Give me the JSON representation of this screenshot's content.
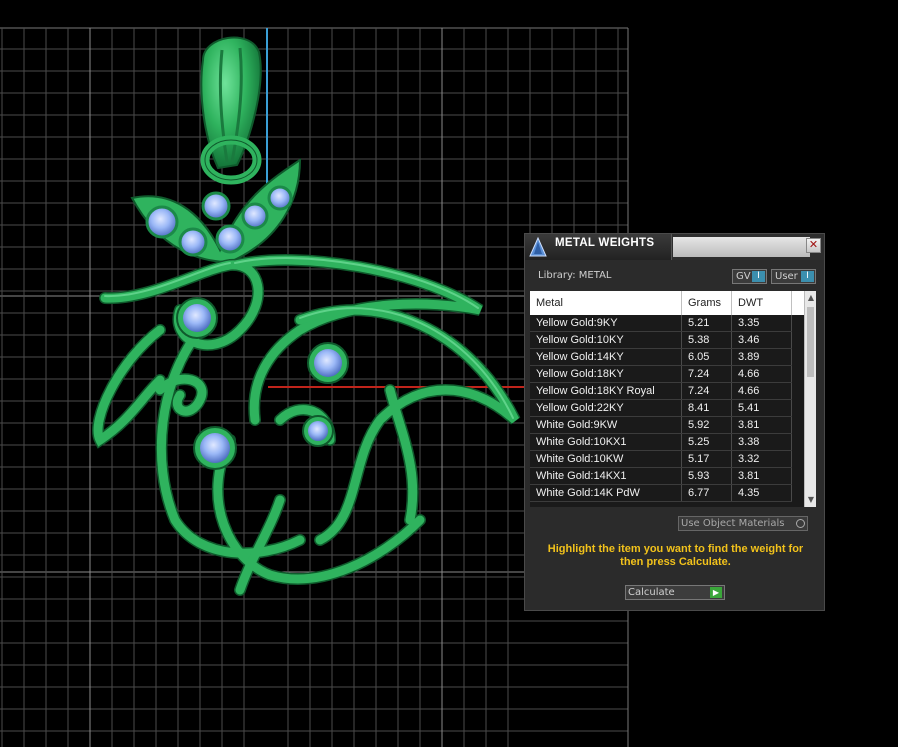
{
  "panel": {
    "title": "METAL WEIGHTS",
    "close_label": "✕",
    "library_label": "Library: METAL",
    "toggle_gv_label": "GV",
    "toggle_user_label": "User",
    "toggle_knob": "I",
    "columns": [
      "Metal",
      "Grams",
      "DWT"
    ],
    "rows": [
      {
        "metal": "Yellow Gold:9KY",
        "grams": "5.21",
        "dwt": "3.35"
      },
      {
        "metal": "Yellow Gold:10KY",
        "grams": "5.38",
        "dwt": "3.46"
      },
      {
        "metal": "Yellow Gold:14KY",
        "grams": "6.05",
        "dwt": "3.89"
      },
      {
        "metal": "Yellow Gold:18KY",
        "grams": "7.24",
        "dwt": "4.66"
      },
      {
        "metal": "Yellow Gold:18KY Royal",
        "grams": "7.24",
        "dwt": "4.66"
      },
      {
        "metal": "Yellow Gold:22KY",
        "grams": "8.41",
        "dwt": "5.41"
      },
      {
        "metal": "White Gold:9KW",
        "grams": "5.92",
        "dwt": "3.81"
      },
      {
        "metal": "White Gold:10KX1",
        "grams": "5.25",
        "dwt": "3.38"
      },
      {
        "metal": "White Gold:10KW",
        "grams": "5.17",
        "dwt": "3.32"
      },
      {
        "metal": "White Gold:14KX1",
        "grams": "5.93",
        "dwt": "3.81"
      },
      {
        "metal": "White Gold:14K PdW",
        "grams": "6.77",
        "dwt": "4.35"
      }
    ],
    "use_object_materials_label": "Use Object Materials",
    "instructions": "Highlight the item you want to find the weight for then press Calculate.",
    "calculate_label": "Calculate",
    "calculate_icon": "play-icon"
  },
  "colors": {
    "background": "#000000",
    "grid": "#555555",
    "model_green": "#2fb35e",
    "gem_blue": "#8fb0f5",
    "accent_yellow": "#f2c21b",
    "axis_red": "#c0241b",
    "axis_blue": "#3a9fd6"
  }
}
